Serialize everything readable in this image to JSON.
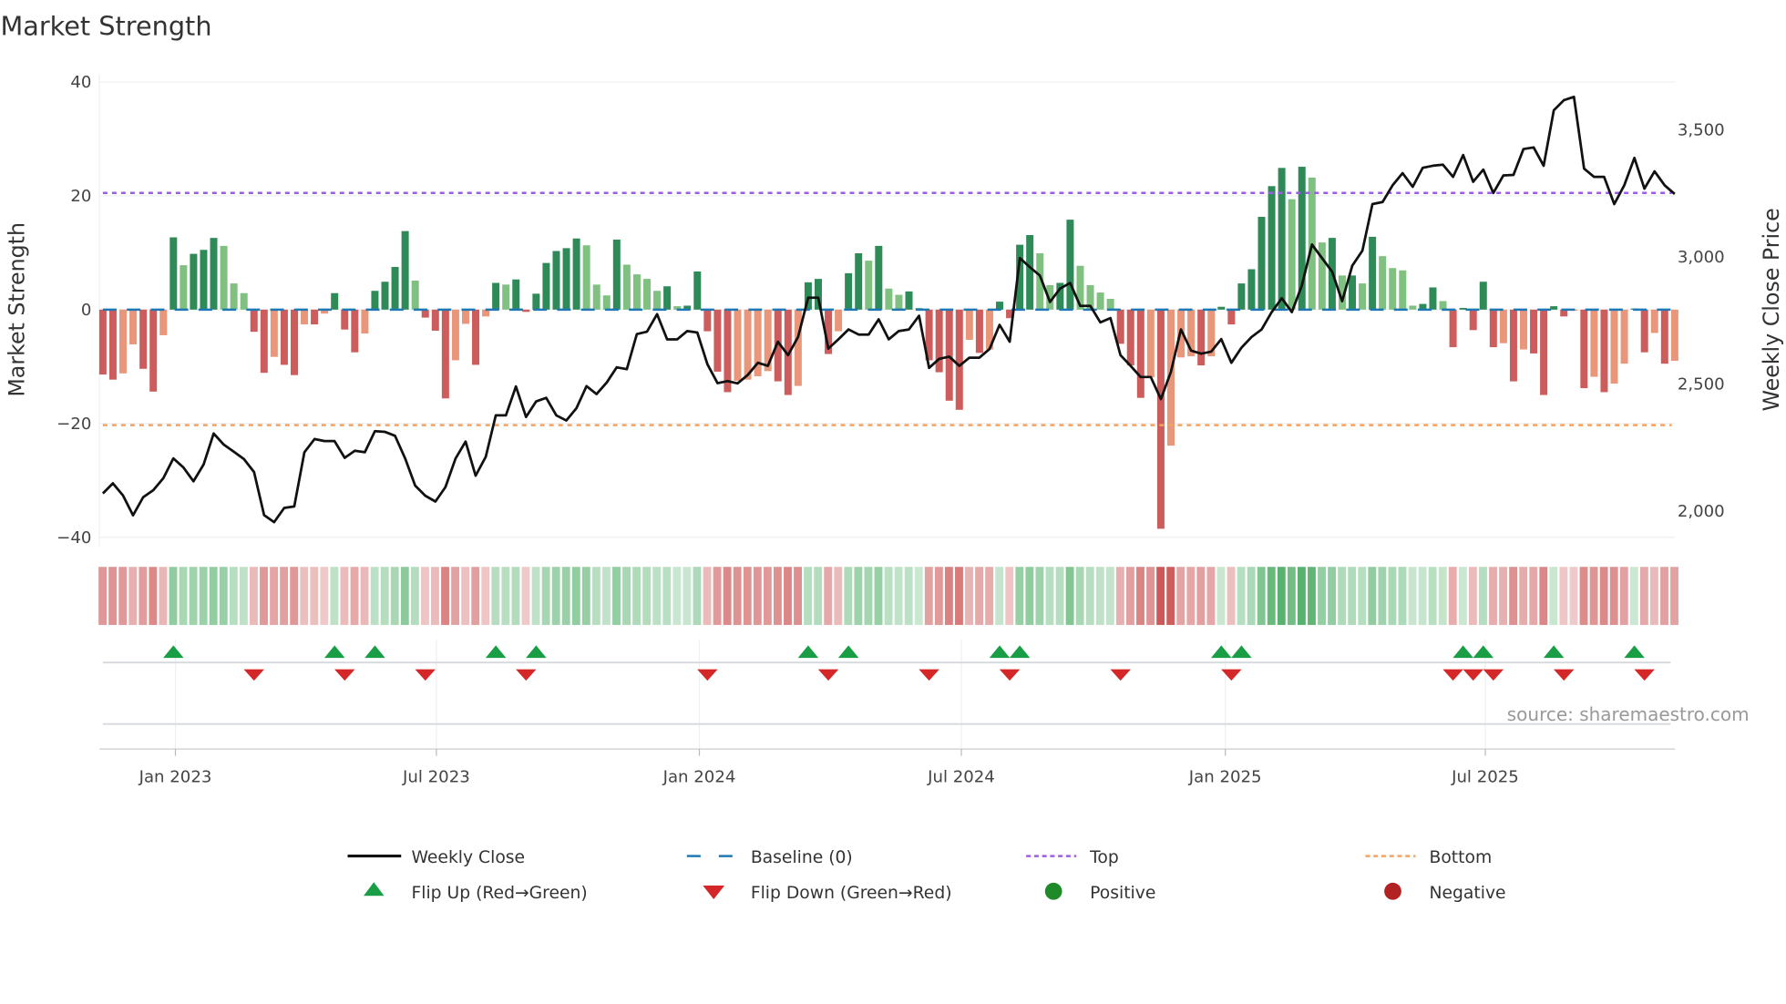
{
  "chart_data": {
    "type": "bar",
    "title": "Market Strength",
    "ylabel": "Market Strength",
    "y2label": "Weekly Close Price",
    "ylim": [
      -40,
      40
    ],
    "y2lim": [
      1800,
      3700
    ],
    "yticks": [
      "40",
      "20",
      "0",
      "−20",
      "−40"
    ],
    "ytick_values": [
      40,
      20,
      0,
      -20,
      -40
    ],
    "y2ticks": [
      "3,500",
      "3,000",
      "2,500",
      "2,000"
    ],
    "y2tick_values": [
      3500,
      3000,
      2500,
      2000
    ],
    "xticks": [
      "Jan 2023",
      "Jul 2023",
      "Jan 2024",
      "Jul 2024",
      "Jan 2025",
      "Jul 2025"
    ],
    "xtick_weeks": [
      7.2,
      33.1,
      59.2,
      85.2,
      111.4,
      137.2
    ],
    "top_level": 20.5,
    "bottom_level": -20.3,
    "baseline": 0,
    "strength": [
      -11.4,
      -12.3,
      -11.2,
      -6.1,
      -10.4,
      -14.4,
      -4.5,
      12.7,
      7.8,
      9.8,
      10.5,
      12.6,
      11.2,
      4.6,
      2.9,
      -3.9,
      -11.1,
      -8.3,
      -9.7,
      -11.5,
      -2.6,
      -2.6,
      -0.7,
      2.9,
      -3.5,
      -7.5,
      -4.2,
      3.3,
      4.9,
      7.5,
      13.8,
      5.1,
      -1.4,
      -3.7,
      -15.6,
      -8.9,
      -2.5,
      -9.7,
      -1.2,
      4.7,
      4.4,
      5.3,
      -0.4,
      2.8,
      8.2,
      10.3,
      10.8,
      12.5,
      11.3,
      4.4,
      2.5,
      12.3,
      7.9,
      6.2,
      5.4,
      3.3,
      4.1,
      0.6,
      0.7,
      6.7,
      -3.8,
      -10.9,
      -14.5,
      -12.5,
      -12.3,
      -11.7,
      -10.8,
      -12.6,
      -15,
      -13.4,
      4.8,
      5.4,
      -7.8,
      -3.8,
      6.4,
      9.9,
      8.6,
      11.2,
      3.7,
      2.6,
      3.2,
      0.3,
      -8.9,
      -11,
      -16,
      -17.6,
      -5.3,
      -7.6,
      -7,
      1.4,
      -1.5,
      11.4,
      13.1,
      9.9,
      4.3,
      4.7,
      15.8,
      7.7,
      4.3,
      3,
      1.9,
      -6,
      -9.8,
      -15.5,
      -11.9,
      -38.5,
      -23.9,
      -8.4,
      -8.2,
      -9.8,
      -8.2,
      0.5,
      -2.6,
      4.6,
      7.1,
      16.3,
      21.7,
      24.9,
      19.4,
      25.1,
      23.2,
      11.8,
      12.6,
      6,
      6,
      4.6,
      12.8,
      9.4,
      7.3,
      6.9,
      0.7,
      1,
      3.9,
      1.5,
      -6.6,
      0.3,
      -3.6,
      4.9,
      -6.6,
      -5.9,
      -12.6,
      -7,
      -7.7,
      -15,
      0.6,
      -1.2,
      -0.2,
      -13.8,
      -11.8,
      -14.5,
      -13,
      -9.5,
      0.2,
      -7.5,
      -4.1,
      -9.5,
      -9
    ],
    "shade": "DDLLDDLDLDDDLLLDDLDDLDLDDDLDDDDLDDDLLDLDLDDDDDDDLLLDLLLLDLDDDDDLLLLDDLDDDLDDLDLLDLDDDDLDLDDDDLLDDLLLLDDDLDLLLDLDDDDDDDLDLLDLDLDLLLLDDLDDDDDLDLDDDDLDLDLLDDLDL",
    "weekly_close": [
      2065,
      2105,
      2057,
      1979,
      2050,
      2078,
      2125,
      2203,
      2167,
      2113,
      2179,
      2301,
      2257,
      2229,
      2200,
      2149,
      1980,
      1952,
      2008,
      2014,
      2227,
      2279,
      2271,
      2271,
      2205,
      2233,
      2227,
      2310,
      2307,
      2292,
      2203,
      2096,
      2056,
      2033,
      2090,
      2203,
      2269,
      2135,
      2209,
      2372,
      2372,
      2486,
      2366,
      2427,
      2441,
      2372,
      2352,
      2400,
      2487,
      2456,
      2501,
      2561,
      2554,
      2692,
      2701,
      2770,
      2671,
      2671,
      2704,
      2698,
      2573,
      2499,
      2507,
      2498,
      2531,
      2579,
      2567,
      2662,
      2609,
      2680,
      2835,
      2835,
      2635,
      2671,
      2710,
      2690,
      2690,
      2750,
      2671,
      2704,
      2710,
      2764,
      2559,
      2594,
      2603,
      2567,
      2599,
      2599,
      2633,
      2728,
      2662,
      2991,
      2955,
      2922,
      2818,
      2871,
      2893,
      2803,
      2803,
      2738,
      2755,
      2609,
      2567,
      2523,
      2523,
      2436,
      2543,
      2710,
      2627,
      2615,
      2623,
      2672,
      2579,
      2638,
      2680,
      2710,
      2778,
      2833,
      2778,
      2883,
      3044,
      2991,
      2937,
      2821,
      2961,
      3020,
      3203,
      3211,
      3277,
      3325,
      3271,
      3346,
      3354,
      3358,
      3310,
      3396,
      3291,
      3339,
      3247,
      3316,
      3318,
      3420,
      3426,
      3354,
      3572,
      3612,
      3625,
      3343,
      3310,
      3310,
      3203,
      3277,
      3385,
      3264,
      3332,
      3277,
      3243
    ],
    "flip_up_weeks": [
      7,
      23,
      27,
      39,
      43,
      70,
      74,
      89,
      91,
      111,
      113,
      135,
      137,
      144,
      152
    ],
    "flip_down_weeks": [
      15,
      24,
      32,
      42,
      60,
      72,
      82,
      90,
      101,
      112,
      134,
      136,
      138,
      145,
      153
    ],
    "legend": {
      "placement": "bottom",
      "items": [
        {
          "label": "Weekly Close",
          "kind": "line"
        },
        {
          "label": "Baseline (0)",
          "kind": "dash"
        },
        {
          "label": "Top",
          "kind": "dot-top"
        },
        {
          "label": "Bottom",
          "kind": "dot-bottom"
        },
        {
          "label": "Flip Up (Red→Green)",
          "kind": "tri-up"
        },
        {
          "label": "Flip Down (Green→Red)",
          "kind": "tri-down"
        },
        {
          "label": "Positive",
          "kind": "circle-pos"
        },
        {
          "label": "Negative",
          "kind": "circle-neg"
        }
      ]
    },
    "source": "source: sharemaestro.com",
    "grid": true
  },
  "colors": {
    "pos_dark": "#2e8b57",
    "pos_light": "#80c080",
    "neg_dark": "#cd5c5c",
    "neg_light": "#e9967a",
    "line": "#111111",
    "baseline": "#1f77b4",
    "top": "#9b5de5",
    "bottom": "#f4a261",
    "flip_up": "#1a9e45",
    "flip_down": "#d62728",
    "positive": "#1f8a2a",
    "negative": "#b22222"
  }
}
